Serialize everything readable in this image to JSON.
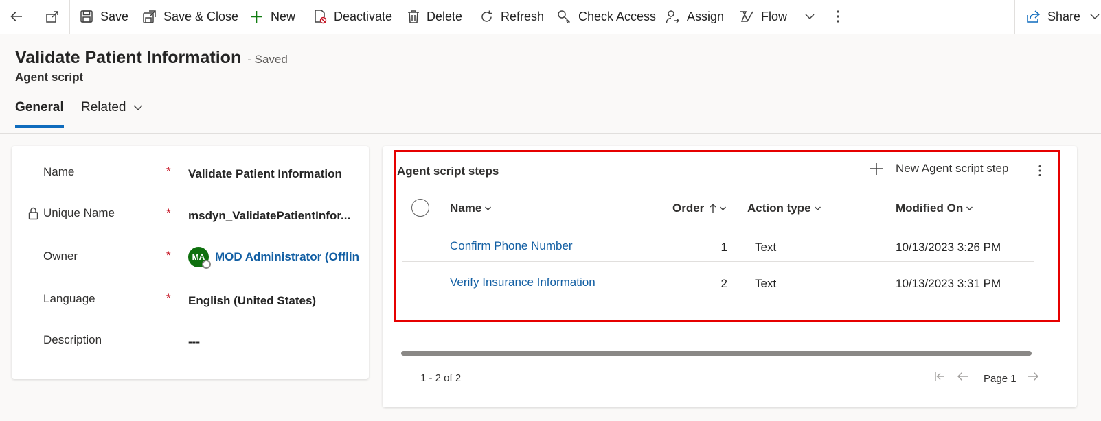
{
  "toolbar": {
    "items": [
      {
        "label": "Save",
        "icon": "save-icon"
      },
      {
        "label": "Save & Close",
        "icon": "save-close-icon"
      },
      {
        "label": "New",
        "icon": "plus-icon"
      },
      {
        "label": "Deactivate",
        "icon": "deactivate-icon"
      },
      {
        "label": "Delete",
        "icon": "trash-icon"
      },
      {
        "label": "Refresh",
        "icon": "refresh-icon"
      },
      {
        "label": "Check Access",
        "icon": "key-icon"
      },
      {
        "label": "Assign",
        "icon": "assign-icon"
      },
      {
        "label": "Flow",
        "icon": "flow-icon"
      }
    ],
    "share_label": "Share"
  },
  "header": {
    "title": "Validate Patient Information",
    "status": "- Saved",
    "entity": "Agent script",
    "tabs": [
      {
        "label": "General",
        "selected": true
      },
      {
        "label": "Related",
        "selected": false
      }
    ]
  },
  "form": {
    "fields": [
      {
        "label": "Name",
        "required": "*",
        "value": "Validate Patient Information"
      },
      {
        "label": "Unique Name",
        "required": "*",
        "value": "msdyn_ValidatePatientInfor..."
      },
      {
        "label": "Owner",
        "required": "*",
        "value": "MOD Administrator (Offlin",
        "initials": "MA"
      },
      {
        "label": "Language",
        "required": "*",
        "value": "English (United States)"
      },
      {
        "label": "Description",
        "required": "",
        "value": "---"
      }
    ]
  },
  "subgrid": {
    "title": "Agent script steps",
    "new_label": "New Agent script step",
    "columns": [
      "Name",
      "Order",
      "Action type",
      "Modified On"
    ],
    "rows": [
      {
        "name": "Confirm Phone Number",
        "order": "1",
        "action_type": "Text",
        "modified_on": "10/13/2023 3:26 PM"
      },
      {
        "name": "Verify Insurance Information",
        "order": "2",
        "action_type": "Text",
        "modified_on": "10/13/2023 3:31 PM"
      }
    ],
    "record_count": "1 - 2 of 2",
    "page_label": "Page 1"
  },
  "colors": {
    "accent": "#0f6cbd",
    "link": "#115ea3",
    "required": "#c50f1f",
    "highlight": "#e60000",
    "avatar": "#0e700e"
  }
}
